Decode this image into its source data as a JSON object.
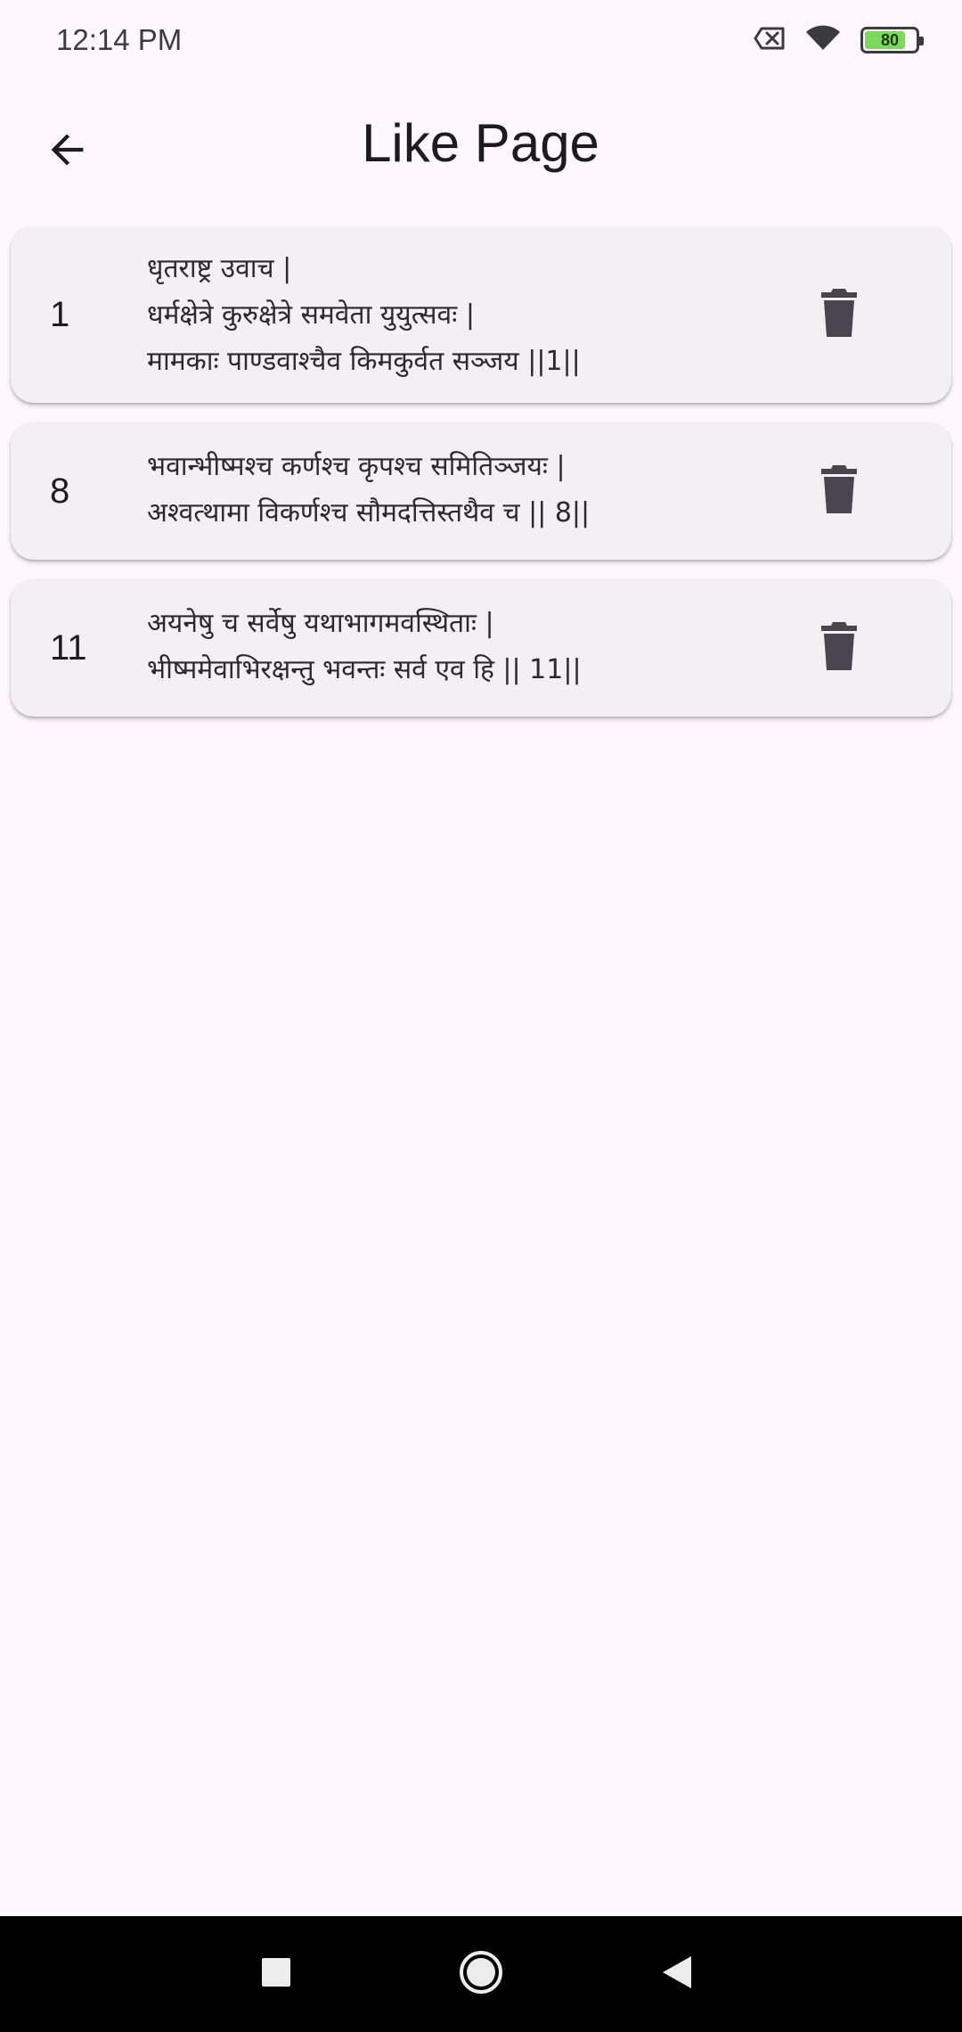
{
  "status_bar": {
    "time": "12:14 PM",
    "battery_level": "80",
    "icons": [
      "sim-none-icon",
      "wifi-icon",
      "battery-icon"
    ]
  },
  "app_bar": {
    "title": "Like Page",
    "back_icon": "arrow-back-icon"
  },
  "liked_verses": [
    {
      "number": "1",
      "lines": [
        "धृतराष्ट्र उवाच |",
        "धर्मक्षेत्रे कुरुक्षेत्रे समवेता युयुत्सवः |",
        "मामकाः पाण्डवाश्चैव किमकुर्वत सञ्जय ||1||"
      ]
    },
    {
      "number": "8",
      "lines": [
        "भवान्भीष्मश्च कर्णश्च कृपश्च समितिञ्जयः |",
        "अश्वत्थामा विकर्णश्च सौमदत्तिस्तथैव च || 8||"
      ]
    },
    {
      "number": "11",
      "lines": [
        "अयनेषु च सर्वेषु यथाभागमवस्थिताः |",
        "भीष्ममेवाभिरक्षन्तु भवन्तः सर्व एव हि || 11||"
      ]
    }
  ],
  "colors": {
    "background": "#fef7fb",
    "card": "#f4eff5",
    "icon": "#49454f",
    "battery_fill": "#7bd95c"
  },
  "nav_bar": {
    "icons": [
      "recents-square-icon",
      "home-circle-icon",
      "back-triangle-icon"
    ]
  }
}
